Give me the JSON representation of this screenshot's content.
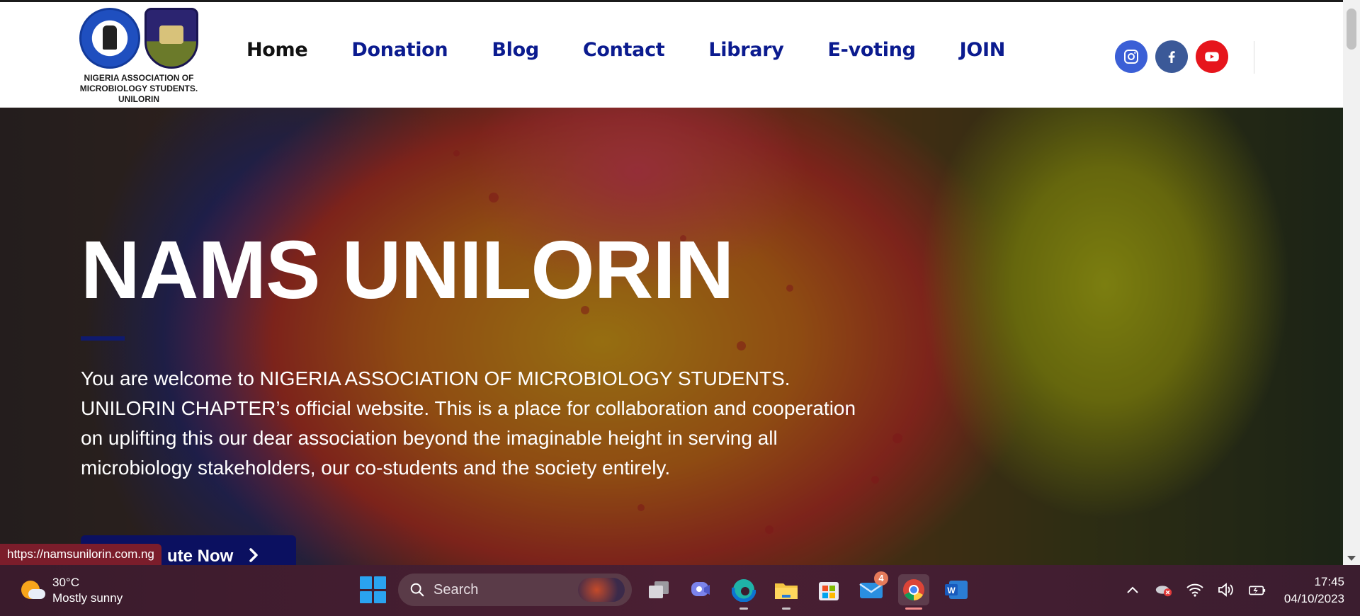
{
  "header": {
    "logo_caption": [
      "NIGERIA ASSOCIATION OF",
      "MICROBIOLOGY STUDENTS.",
      "UNILORIN"
    ],
    "nav": [
      {
        "label": "Home",
        "active": true
      },
      {
        "label": "Donation"
      },
      {
        "label": "Blog"
      },
      {
        "label": "Contact"
      },
      {
        "label": "Library"
      },
      {
        "label": "E-voting"
      },
      {
        "label": "JOIN"
      }
    ],
    "social": [
      "instagram-icon",
      "facebook-icon",
      "youtube-icon"
    ]
  },
  "hero": {
    "title": "NAMS UNILORIN",
    "text": "You are welcome to NIGERIA ASSOCIATION OF MICROBIOLOGY STUDENTS. UNILORIN CHAPTER’s official website. This is a place for collaboration and cooperation on uplifting this our dear association beyond the imaginable height in serving all microbiology stakeholders, our co-students and the society entirely.",
    "cta_label": "ute Now"
  },
  "status_bar": {
    "url": "https://namsunilorin.com.ng"
  },
  "taskbar": {
    "weather": {
      "temp": "30°C",
      "condition": "Mostly sunny"
    },
    "search_label": "Search",
    "mail_badge": "4",
    "time": "17:45",
    "date": "04/10/2023"
  },
  "colors": {
    "nav": "#0b1b8f",
    "accent": "#0f1a6e",
    "youtube": "#e6151c"
  }
}
